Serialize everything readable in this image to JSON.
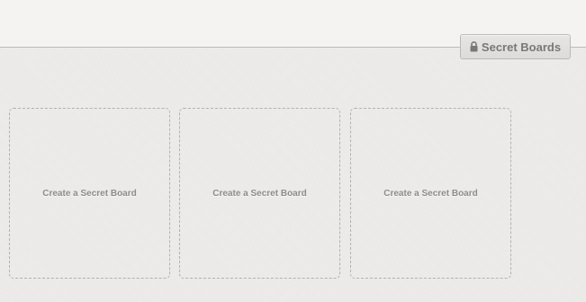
{
  "header": {
    "secret_boards_button": {
      "label": "Secret Boards",
      "icon": "lock-icon"
    }
  },
  "boards": [
    {
      "label": "Create a Secret Board"
    },
    {
      "label": "Create a Secret Board"
    },
    {
      "label": "Create a Secret Board"
    }
  ],
  "colors": {
    "header_bg": "#f4f3f2",
    "content_bg": "#eceae9",
    "divider": "#bdbbba",
    "dashed_border": "#b3b1b0",
    "label_text": "#8e8c8b",
    "button_text": "#7a7877"
  }
}
